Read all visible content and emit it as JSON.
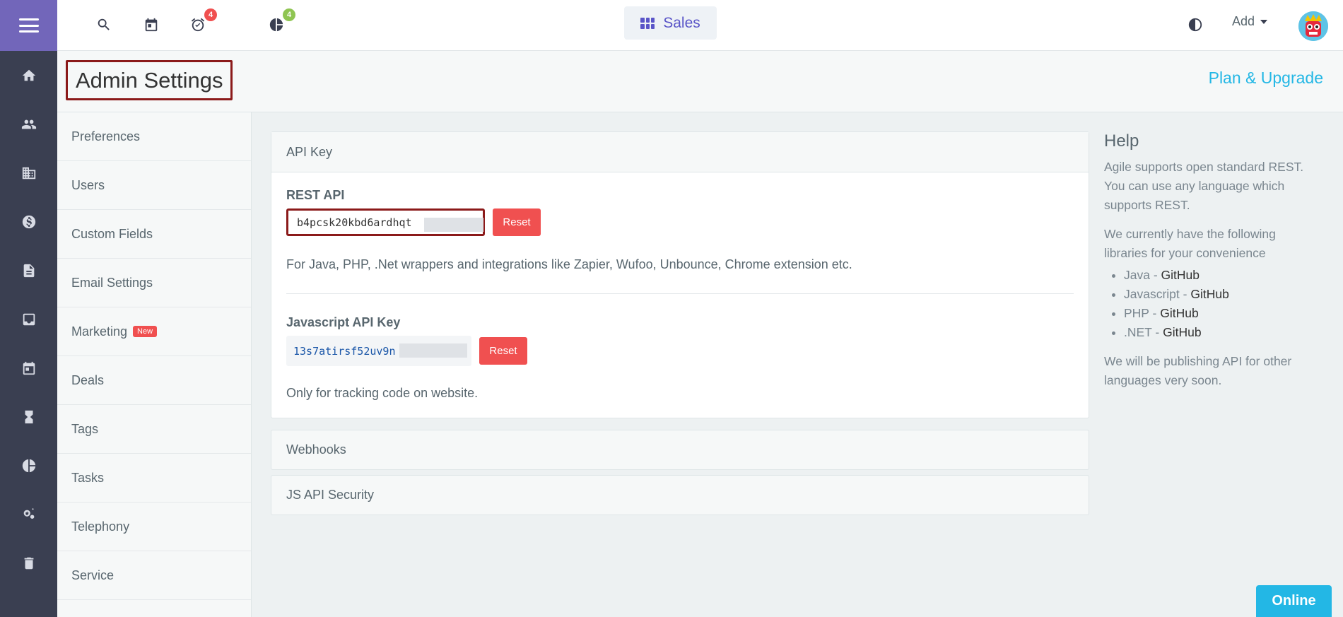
{
  "topbar": {
    "reminders_badge": "4",
    "reports_badge": "4",
    "module_label": "Sales",
    "add_label": "Add"
  },
  "header": {
    "title": "Admin Settings",
    "plan_link": "Plan & Upgrade"
  },
  "settings_nav": [
    {
      "label": "Preferences"
    },
    {
      "label": "Users"
    },
    {
      "label": "Custom Fields"
    },
    {
      "label": "Email Settings"
    },
    {
      "label": "Marketing",
      "badge": "New"
    },
    {
      "label": "Deals"
    },
    {
      "label": "Tags"
    },
    {
      "label": "Tasks"
    },
    {
      "label": "Telephony"
    },
    {
      "label": "Service"
    }
  ],
  "api_panel": {
    "heading": "API Key",
    "rest_label": "REST API",
    "rest_key": "b4pcsk20kbd6ardhqt",
    "reset_label": "Reset",
    "rest_desc": "For Java, PHP, .Net wrappers and integrations like Zapier, Wufoo, Unbounce, Chrome extension etc.",
    "js_label": "Javascript API Key",
    "js_key": "13s7atirsf52uv9n",
    "js_desc": "Only for tracking code on website."
  },
  "collapsed_panels": [
    "Webhooks",
    "JS API Security"
  ],
  "help": {
    "title": "Help",
    "p1": "Agile supports open standard REST. You can use any language which supports REST.",
    "p2": "We currently have the following libraries for your convenience",
    "libs": [
      {
        "lang": "Java",
        "sep": " - ",
        "link": "GitHub"
      },
      {
        "lang": "Javascript",
        "sep": " - ",
        "link": "GitHub"
      },
      {
        "lang": "PHP",
        "sep": " - ",
        "link": "GitHub"
      },
      {
        "lang": ".NET",
        "sep": " - ",
        "link": "GitHub"
      }
    ],
    "p3": "We will be publishing API for other languages very soon."
  },
  "status_button": "Online",
  "colors": {
    "accent_purple": "#7266ba",
    "link_blue": "#23b7e5",
    "danger_red": "#f05050",
    "highlight_border": "#8b1a1a"
  }
}
